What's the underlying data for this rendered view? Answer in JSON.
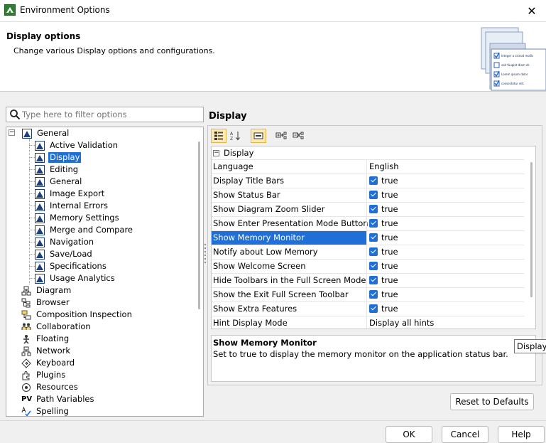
{
  "window": {
    "title": "Environment Options",
    "close_glyph": "✕"
  },
  "header": {
    "title": "Display options",
    "subtitle": "Change various Display options and configurations.",
    "art_items": [
      "Integer a sisnod mollis",
      "sed faugiat diam et.",
      "Lorem ipsum dolor",
      "consectetur elit."
    ]
  },
  "filter": {
    "placeholder": "Type here to filter options"
  },
  "tree": {
    "selected": "Display",
    "root": {
      "label": "General",
      "expanded": true,
      "toggle": "−"
    },
    "children": [
      "Active Validation",
      "Display",
      "Editing",
      "General",
      "Image Export",
      "Internal Errors",
      "Memory Settings",
      "Merge and Compare",
      "Navigation",
      "Save/Load",
      "Specifications",
      "Usage Analytics"
    ],
    "top_items": [
      {
        "label": "Diagram",
        "icon": "diagram-icon"
      },
      {
        "label": "Browser",
        "icon": "browser-icon"
      },
      {
        "label": "Composition Inspection",
        "icon": "composition-icon"
      },
      {
        "label": "Collaboration",
        "icon": "collaboration-icon"
      },
      {
        "label": "Floating",
        "icon": "floating-icon"
      },
      {
        "label": "Network",
        "icon": "network-icon"
      },
      {
        "label": "Keyboard",
        "icon": "keyboard-icon"
      },
      {
        "label": "Plugins",
        "icon": "plugins-icon"
      },
      {
        "label": "Resources",
        "icon": "resources-icon"
      },
      {
        "label": "Path Variables",
        "icon": "path-variables-icon",
        "glyph": "PV"
      },
      {
        "label": "Spelling",
        "icon": "spelling-icon"
      }
    ]
  },
  "panel": {
    "title": "Display",
    "group_label": "Display",
    "group_toggle": "−",
    "properties": [
      {
        "name": "Language",
        "value": "English",
        "checkbox": false
      },
      {
        "name": "Display Title Bars",
        "value": "true",
        "checkbox": true
      },
      {
        "name": "Show Status Bar",
        "value": "true",
        "checkbox": true
      },
      {
        "name": "Show Diagram Zoom Slider",
        "value": "true",
        "checkbox": true
      },
      {
        "name": "Show Enter Presentation Mode Button",
        "value": "true",
        "checkbox": true
      },
      {
        "name": "Show Memory Monitor",
        "value": "true",
        "checkbox": true,
        "selected": true
      },
      {
        "name": "Notify about Low Memory",
        "value": "true",
        "checkbox": true
      },
      {
        "name": "Show Welcome Screen",
        "value": "true",
        "checkbox": true
      },
      {
        "name": "Hide Toolbars in the Full Screen Mode",
        "value": "true",
        "checkbox": true
      },
      {
        "name": "Show the Exit Full Screen Toolbar",
        "value": "true",
        "checkbox": true
      },
      {
        "name": "Show Extra Features",
        "value": "true",
        "checkbox": true
      },
      {
        "name": "Hint Display Mode",
        "value": "Display all hints",
        "checkbox": false
      }
    ],
    "description": {
      "title": "Show Memory Monitor",
      "text": "Set to true to display the memory monitor on the application status bar."
    },
    "tooltip": "Display"
  },
  "buttons": {
    "reset": "Reset to Defaults",
    "ok": "OK",
    "cancel": "Cancel",
    "help": "Help"
  },
  "colors": {
    "selection": "#1f6fd6",
    "active_tool": "#fde9b2"
  }
}
